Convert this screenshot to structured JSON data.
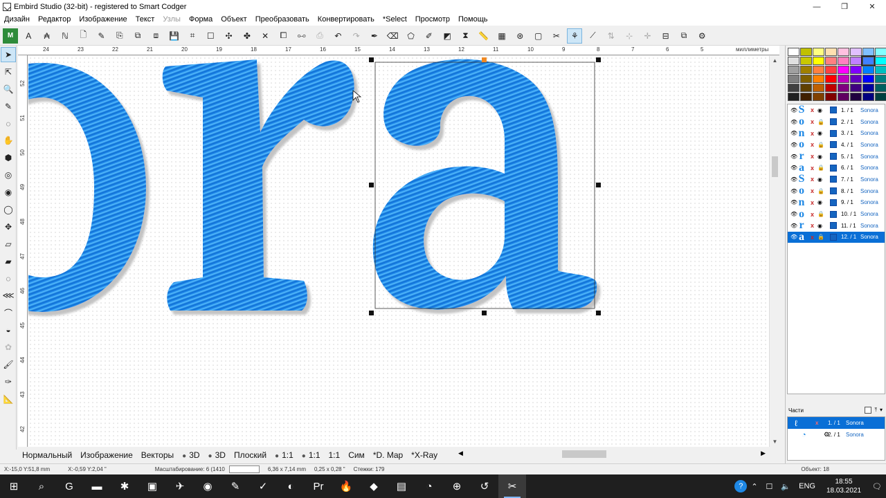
{
  "window": {
    "title": "Embird Studio (32-bit)  - registered to Smart Codger",
    "controls": [
      "—",
      "❐",
      "✕"
    ]
  },
  "menu": [
    {
      "label": "Дизайн",
      "enabled": true
    },
    {
      "label": "Редактор",
      "enabled": true
    },
    {
      "label": "Изображение",
      "enabled": true
    },
    {
      "label": "Текст",
      "enabled": true
    },
    {
      "label": "Узлы",
      "enabled": false
    },
    {
      "label": "Форма",
      "enabled": true
    },
    {
      "label": "Объект",
      "enabled": true
    },
    {
      "label": "Преобразовать",
      "enabled": true
    },
    {
      "label": "Конвертировать",
      "enabled": true
    },
    {
      "label": "*Select",
      "enabled": true
    },
    {
      "label": "Просмотр",
      "enabled": true
    },
    {
      "label": "Помощь",
      "enabled": true
    }
  ],
  "ruler": {
    "unit": "миллиметры",
    "top_labels": [
      "24",
      "23",
      "22",
      "21",
      "20",
      "19",
      "18",
      "17",
      "16",
      "15",
      "14",
      "13",
      "12",
      "11",
      "10",
      "9",
      "8",
      "7",
      "6",
      "5"
    ],
    "left_labels": [
      "52",
      "51",
      "50",
      "49",
      "48",
      "47",
      "46",
      "45",
      "44",
      "43",
      "42"
    ]
  },
  "canvas": {
    "design_colors": {
      "thread_dark": "#0b6fd9",
      "thread_mid": "#1e90ff",
      "thread_light": "#5ec4ff",
      "shadow": "#c8c8c8"
    }
  },
  "objects": [
    {
      "letter": "S",
      "num": "1.  / 1",
      "name": "Sonora"
    },
    {
      "letter": "o",
      "num": "2.  / 1",
      "name": "Sonora"
    },
    {
      "letter": "n",
      "num": "3.  / 1",
      "name": "Sonora"
    },
    {
      "letter": "o",
      "num": "4.  / 1",
      "name": "Sonora"
    },
    {
      "letter": "r",
      "num": "5.  / 1",
      "name": "Sonora"
    },
    {
      "letter": "a",
      "num": "6.  / 1",
      "name": "Sonora"
    },
    {
      "letter": "S",
      "num": "7.  / 1",
      "name": "Sonora"
    },
    {
      "letter": "o",
      "num": "8.  / 1",
      "name": "Sonora"
    },
    {
      "letter": "n",
      "num": "9.  / 1",
      "name": "Sonora"
    },
    {
      "letter": "o",
      "num": "10.  / 1",
      "name": "Sonora"
    },
    {
      "letter": "r",
      "num": "11.  / 1",
      "name": "Sonora"
    },
    {
      "letter": "a",
      "num": "12.  / 1",
      "name": "Sonora",
      "selected": true
    }
  ],
  "parts": {
    "header": "Части",
    "rows": [
      {
        "num": "1.  / 1",
        "name": "Sonora",
        "selected": true
      },
      {
        "num": "2.  / 1",
        "name": "Sonora"
      }
    ]
  },
  "view_bar": [
    {
      "label": "Нормальный",
      "dot": false
    },
    {
      "label": "Изображение",
      "dot": false
    },
    {
      "label": "Векторы",
      "dot": false
    },
    {
      "label": "3D",
      "dot": true
    },
    {
      "label": "3D",
      "dot": true
    },
    {
      "label": "Плоский",
      "dot": false
    },
    {
      "label": "1:1",
      "dot": true
    },
    {
      "label": "1:1",
      "dot": true
    },
    {
      "label": "1:1",
      "dot": false
    },
    {
      "label": "Сим",
      "dot": false
    },
    {
      "label": "*D. Map",
      "dot": false
    },
    {
      "label": "*X-Ray",
      "dot": false
    }
  ],
  "status": {
    "coords": "X:-15,0  Y:51,8 mm",
    "rel": "X:-0,59  Y:2,04 \"",
    "zoom": "Масштабирование: 6 (1410",
    "size_mm": "6,36 x 7,14 mm",
    "size_in": "0,25 x 0,28 \"",
    "stitches": "Стежки: 179",
    "object": "Объект: 18"
  },
  "taskbar": {
    "apps": [
      "⊞",
      "⌕",
      "G",
      "▬",
      "✱",
      "▣",
      "✈",
      "◉",
      "✎",
      "✓",
      "◐",
      "Pr",
      "🔥",
      "◆",
      "▤",
      "◔",
      "⊕",
      "↺",
      "✂"
    ],
    "lang": "ENG",
    "time": "18:55",
    "date": "18.03.2021"
  },
  "palette_colors": [
    "#ffffff",
    "#c0c000",
    "#ffff80",
    "#ffe0b0",
    "#ffc0e0",
    "#e0c0ff",
    "#80c0ff",
    "#80ffff",
    "#e0e0e0",
    "#c8c800",
    "#ffff00",
    "#ff8080",
    "#ff80c0",
    "#c080ff",
    "#4080ff",
    "#00ffff",
    "#a0a0a0",
    "#a08000",
    "#ff8040",
    "#ff4040",
    "#ff00ff",
    "#8000ff",
    "#0080ff",
    "#00c0c0",
    "#808080",
    "#806000",
    "#ff8000",
    "#ff0000",
    "#c000c0",
    "#6000c0",
    "#0000ff",
    "#008080",
    "#404040",
    "#604000",
    "#c06000",
    "#c00000",
    "#800080",
    "#400080",
    "#0000a0",
    "#006060",
    "#202020",
    "#402000",
    "#804000",
    "#800000",
    "#600060",
    "#200040",
    "#000080",
    "#004040"
  ]
}
